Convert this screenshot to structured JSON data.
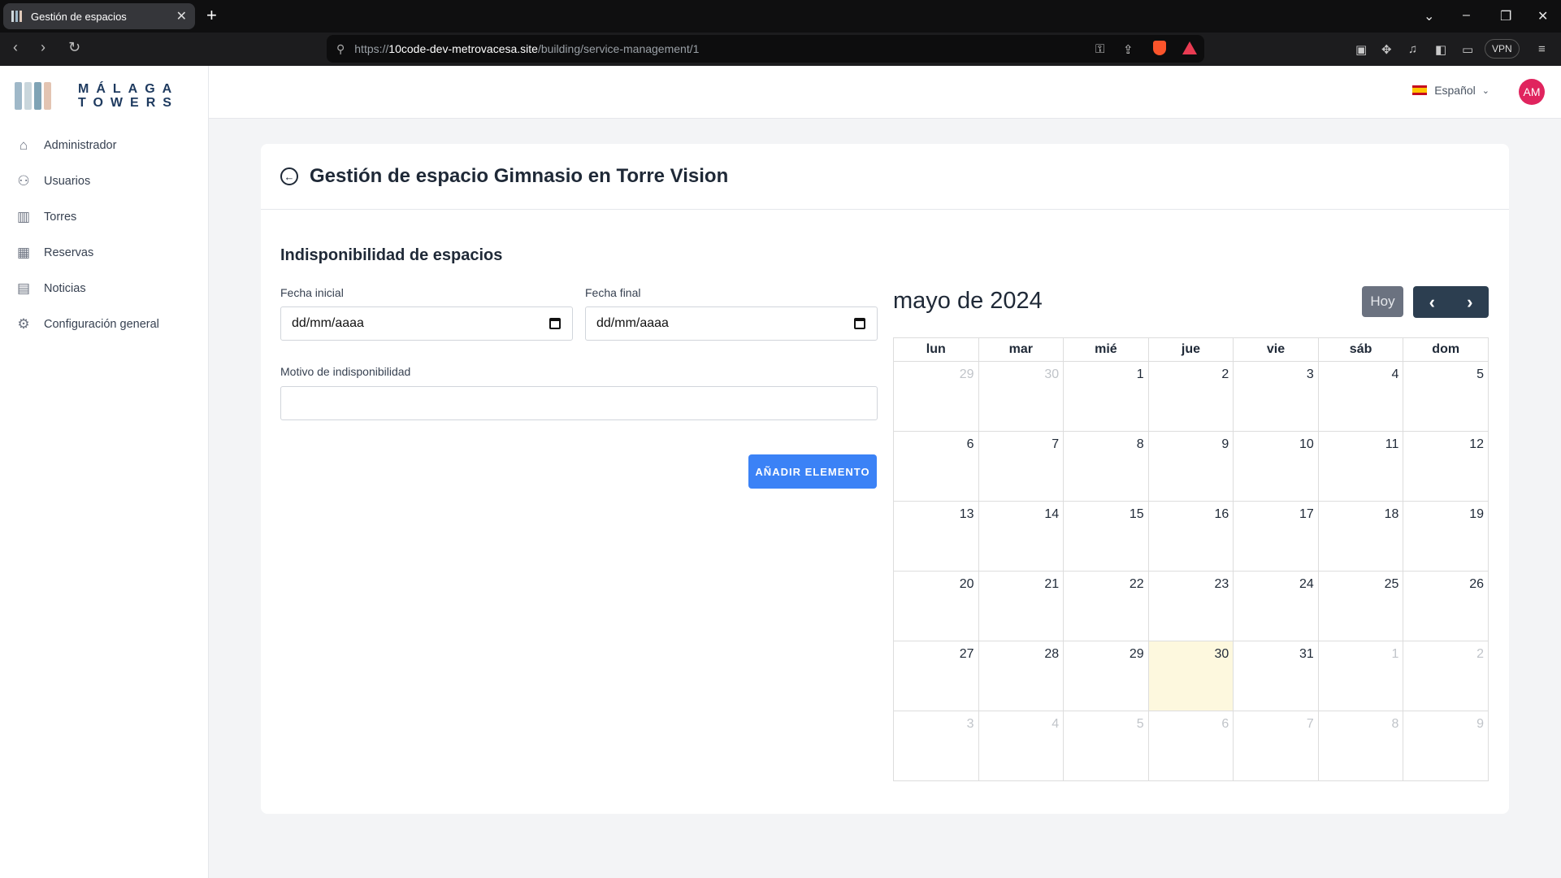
{
  "browser": {
    "tab_title": "Gestión de espacios",
    "url_prefix": "https://",
    "url_host": "10code-dev-metrovacesa.site",
    "url_path": "/building/service-management/1",
    "vpn_label": "VPN"
  },
  "logo": {
    "line1": "MÁLAGA",
    "line2": "TOWERS"
  },
  "sidebar": {
    "items": [
      {
        "label": "Administrador",
        "icon": "home-icon"
      },
      {
        "label": "Usuarios",
        "icon": "users-icon"
      },
      {
        "label": "Torres",
        "icon": "building-icon"
      },
      {
        "label": "Reservas",
        "icon": "calendar-icon"
      },
      {
        "label": "Noticias",
        "icon": "newspaper-icon"
      },
      {
        "label": "Configuración general",
        "icon": "gear-icon"
      }
    ]
  },
  "topbar": {
    "language": "Español",
    "avatar_initials": "AM"
  },
  "page": {
    "title": "Gestión de espacio Gimnasio en Torre Vision",
    "section_title": "Indisponibilidad de espacios",
    "start_label": "Fecha inicial",
    "start_placeholder": "dd/mm/aaaa",
    "end_label": "Fecha final",
    "end_placeholder": "dd/mm/aaaa",
    "reason_label": "Motivo de indisponibilidad",
    "reason_value": "",
    "add_button": "AÑADIR ELEMENTO"
  },
  "calendar": {
    "title": "mayo de 2024",
    "today_button": "Hoy",
    "weekdays": [
      "lun",
      "mar",
      "mié",
      "jue",
      "vie",
      "sáb",
      "dom"
    ],
    "weeks": [
      [
        {
          "d": "29",
          "o": true
        },
        {
          "d": "30",
          "o": true
        },
        {
          "d": "1"
        },
        {
          "d": "2"
        },
        {
          "d": "3"
        },
        {
          "d": "4"
        },
        {
          "d": "5"
        }
      ],
      [
        {
          "d": "6"
        },
        {
          "d": "7"
        },
        {
          "d": "8"
        },
        {
          "d": "9"
        },
        {
          "d": "10"
        },
        {
          "d": "11"
        },
        {
          "d": "12"
        }
      ],
      [
        {
          "d": "13"
        },
        {
          "d": "14"
        },
        {
          "d": "15"
        },
        {
          "d": "16"
        },
        {
          "d": "17"
        },
        {
          "d": "18"
        },
        {
          "d": "19"
        }
      ],
      [
        {
          "d": "20"
        },
        {
          "d": "21"
        },
        {
          "d": "22"
        },
        {
          "d": "23"
        },
        {
          "d": "24"
        },
        {
          "d": "25"
        },
        {
          "d": "26"
        }
      ],
      [
        {
          "d": "27"
        },
        {
          "d": "28"
        },
        {
          "d": "29"
        },
        {
          "d": "30",
          "today": true
        },
        {
          "d": "31"
        },
        {
          "d": "1",
          "o": true
        },
        {
          "d": "2",
          "o": true
        }
      ],
      [
        {
          "d": "3",
          "o": true
        },
        {
          "d": "4",
          "o": true
        },
        {
          "d": "5",
          "o": true
        },
        {
          "d": "6",
          "o": true
        },
        {
          "d": "7",
          "o": true
        },
        {
          "d": "8",
          "o": true
        },
        {
          "d": "9",
          "o": true
        }
      ]
    ],
    "today_color": "#fdf8de"
  },
  "colors": {
    "primary": "#3b82f6",
    "dark_nav": "#2c3e50",
    "avatar": "#e0245e"
  }
}
